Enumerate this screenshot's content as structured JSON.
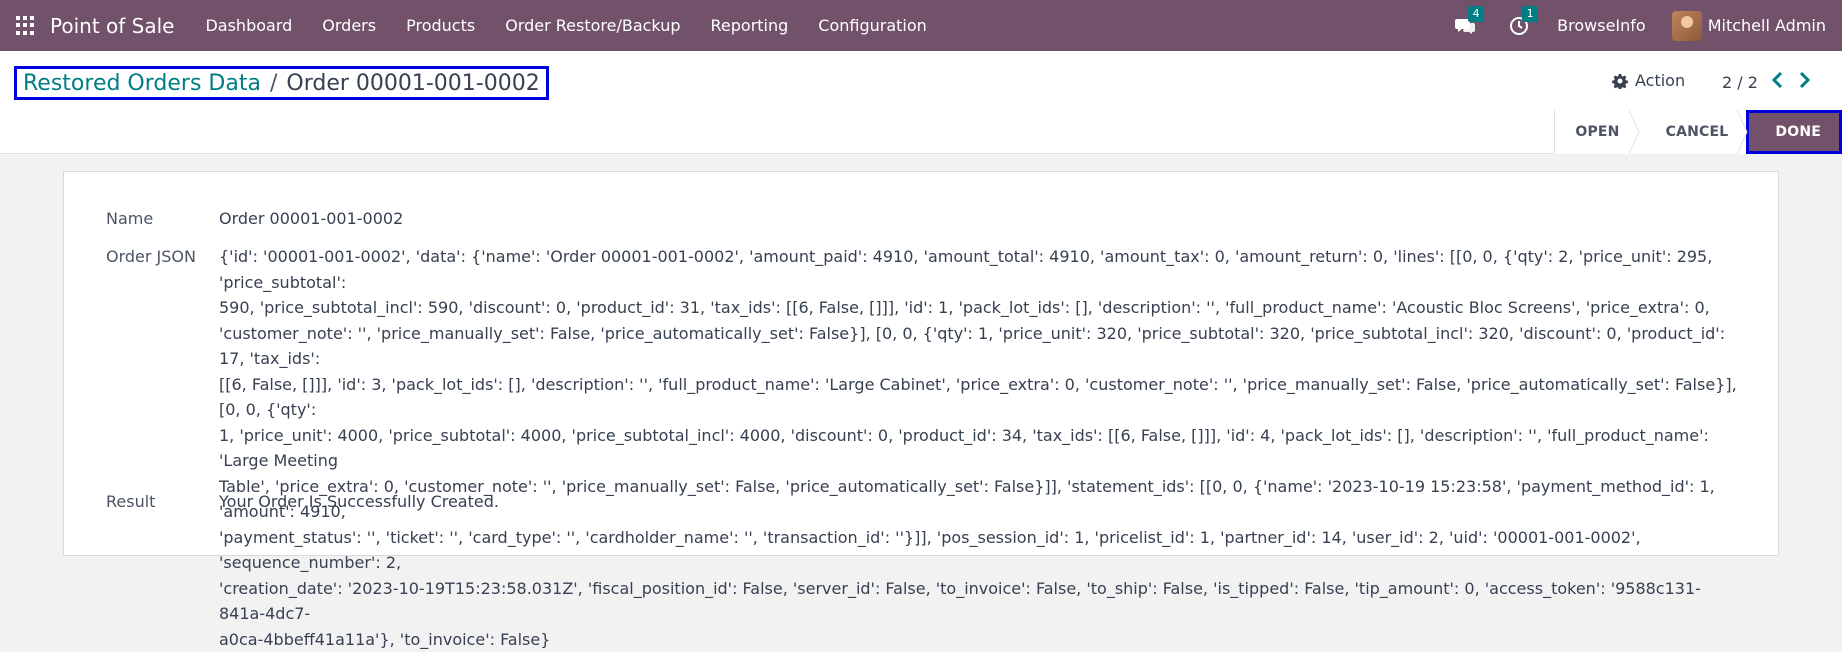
{
  "navbar": {
    "app_name": "Point of Sale",
    "menu": [
      "Dashboard",
      "Orders",
      "Products",
      "Order Restore/Backup",
      "Reporting",
      "Configuration"
    ],
    "messages_count": "4",
    "activities_count": "1",
    "company": "BrowseInfo",
    "user": "Mitchell Admin"
  },
  "control_panel": {
    "breadcrumb_parent": "Restored Orders Data",
    "breadcrumb_separator": "/",
    "breadcrumb_current": "Order 00001-001-0002",
    "action_label": "Action",
    "pager": "2 / 2"
  },
  "statusbar": {
    "steps": [
      "OPEN",
      "CANCEL",
      "DONE"
    ],
    "active": "DONE"
  },
  "form": {
    "name_label": "Name",
    "name_value": "Order 00001-001-0002",
    "json_label": "Order JSON",
    "json_lines": [
      "{'id': '00001-001-0002', 'data': {'name': 'Order 00001-001-0002', 'amount_paid': 4910, 'amount_total': 4910, 'amount_tax': 0, 'amount_return': 0, 'lines': [[0, 0, {'qty': 2, 'price_unit': 295, 'price_subtotal':",
      "590, 'price_subtotal_incl': 590, 'discount': 0, 'product_id': 31, 'tax_ids': [[6, False, []]], 'id': 1, 'pack_lot_ids': [], 'description': '', 'full_product_name': 'Acoustic Bloc Screens', 'price_extra': 0,",
      "'customer_note': '', 'price_manually_set': False, 'price_automatically_set': False}], [0, 0, {'qty': 1, 'price_unit': 320, 'price_subtotal': 320, 'price_subtotal_incl': 320, 'discount': 0, 'product_id': 17, 'tax_ids':",
      "[[6, False, []]], 'id': 3, 'pack_lot_ids': [], 'description': '', 'full_product_name': 'Large Cabinet', 'price_extra': 0, 'customer_note': '', 'price_manually_set': False, 'price_automatically_set': False}], [0, 0, {'qty':",
      "1, 'price_unit': 4000, 'price_subtotal': 4000, 'price_subtotal_incl': 4000, 'discount': 0, 'product_id': 34, 'tax_ids': [[6, False, []]], 'id': 4, 'pack_lot_ids': [], 'description': '', 'full_product_name': 'Large Meeting",
      "Table', 'price_extra': 0, 'customer_note': '', 'price_manually_set': False, 'price_automatically_set': False}]], 'statement_ids': [[0, 0, {'name': '2023-10-19 15:23:58', 'payment_method_id': 1, 'amount': 4910,",
      "'payment_status': '', 'ticket': '', 'card_type': '', 'cardholder_name': '', 'transaction_id': ''}]], 'pos_session_id': 1, 'pricelist_id': 1, 'partner_id': 14, 'user_id': 2, 'uid': '00001-001-0002', 'sequence_number': 2,",
      "'creation_date': '2023-10-19T15:23:58.031Z', 'fiscal_position_id': False, 'server_id': False, 'to_invoice': False, 'to_ship': False, 'is_tipped': False, 'tip_amount': 0, 'access_token': '9588c131-841a-4dc7-",
      "a0ca-4bbeff41a11a'}, 'to_invoice': False}"
    ],
    "result_label": "Result",
    "result_value": "Your Order Is Successfully Created."
  },
  "colors": {
    "navbar": "#71526a",
    "link": "#017e84",
    "highlight_border": "#0000dd"
  },
  "icons": [
    "apps-grid-icon",
    "chat-icon",
    "clock-icon",
    "gear-icon",
    "chevron-left-icon",
    "chevron-right-icon"
  ]
}
